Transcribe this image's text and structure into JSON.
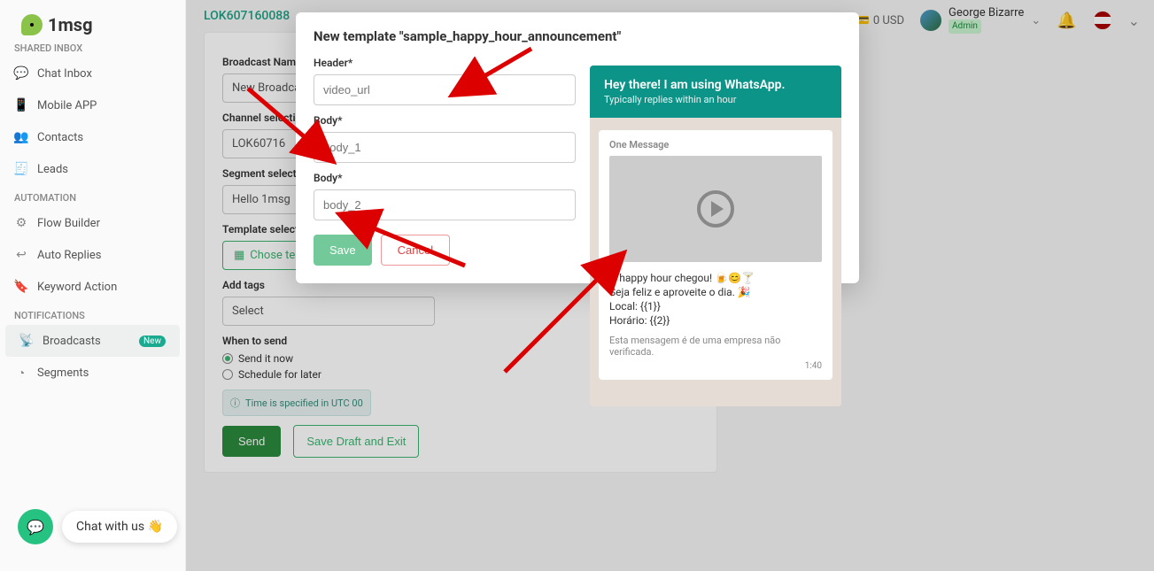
{
  "logo_text": "1msg",
  "balance": "0 USD",
  "user_name": "George Bizarre",
  "user_role": "Admin",
  "breadcrumb": "LOK607160088",
  "sidebar": {
    "sections": {
      "shared": "SHARED INBOX",
      "automation": "AUTOMATION",
      "notifications": "NOTIFICATIONS"
    },
    "items": {
      "chat_inbox": "Chat Inbox",
      "mobile_app": "Mobile APP",
      "contacts": "Contacts",
      "leads": "Leads",
      "flow_builder": "Flow Builder",
      "auto_replies": "Auto Replies",
      "keyword_action": "Keyword Action",
      "broadcasts": "Broadcasts",
      "segments": "Segments"
    },
    "new_badge": "New"
  },
  "form": {
    "labels": {
      "broadcast_name": "Broadcast Name",
      "channel": "Channel selection",
      "segment": "Segment selection",
      "template": "Template selection",
      "tags": "Add tags",
      "when": "When to send"
    },
    "values": {
      "broadcast_name": "New Broadcast",
      "channel": "LOK60716",
      "segment": "Hello 1msg",
      "template_btn": "Chose template",
      "tags": "Select"
    },
    "radio": {
      "now": "Send it now",
      "schedule": "Schedule for later"
    },
    "utc_note": "Time is specified in UTC 00",
    "send": "Send",
    "draft": "Save Draft and Exit"
  },
  "modal": {
    "title": "New template  \"sample_happy_hour_announcement\"",
    "header_label": "Header*",
    "header_placeholder": "video_url",
    "body1_label": "Body*",
    "body1_placeholder": "body_1",
    "body2_label": "Body*",
    "body2_placeholder": "body_2",
    "save": "Save",
    "cancel": "Cancel"
  },
  "preview": {
    "header_title": "Hey there! I am using WhatsApp.",
    "header_sub": "Typically replies within an hour",
    "one_message": "One Message",
    "line1": "O happy hour chegou! 🍺😊🍸",
    "line2": "Seja feliz e aproveite o dia. 🎉",
    "line3": "Local: {{1}}",
    "line4": "Horário: {{2}}",
    "footer": "Esta mensagem é de uma empresa não verificada.",
    "time": "1:40"
  },
  "chat_pill": "Chat with us 👋"
}
